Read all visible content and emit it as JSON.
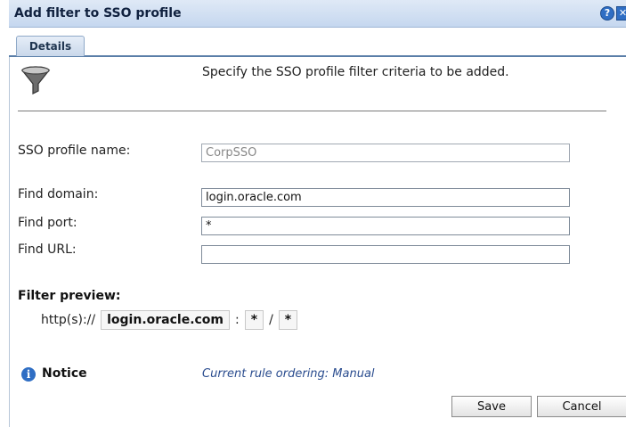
{
  "dialog": {
    "title": "Add filter to SSO profile",
    "help_glyph": "?",
    "close_glyph": "✕"
  },
  "tabs": [
    {
      "label": "Details"
    }
  ],
  "instruction": "Specify the SSO profile filter criteria to be added.",
  "form": {
    "profile_name_label": "SSO profile name:",
    "profile_name_value": "CorpSSO",
    "domain_label": "Find domain:",
    "domain_value": "login.oracle.com",
    "port_label": "Find port:",
    "port_value": "*",
    "url_label": "Find URL:",
    "url_value": ""
  },
  "preview": {
    "title": "Filter preview:",
    "prefix": "http(s)://",
    "domain": "login.oracle.com",
    "colon": ":",
    "port": "*",
    "slash": "/",
    "path": "*"
  },
  "notice": {
    "icon_glyph": "i",
    "label": "Notice",
    "value": "Current rule ordering: Manual"
  },
  "buttons": {
    "save": "Save",
    "cancel": "Cancel"
  },
  "icons": {
    "filter": "funnel-icon",
    "help": "help-icon",
    "close": "close-icon",
    "notice": "info-icon"
  },
  "colors": {
    "title_bar": "#c5d7ef",
    "accent": "#2f6ec4",
    "notice_text": "#2b4d8f"
  }
}
